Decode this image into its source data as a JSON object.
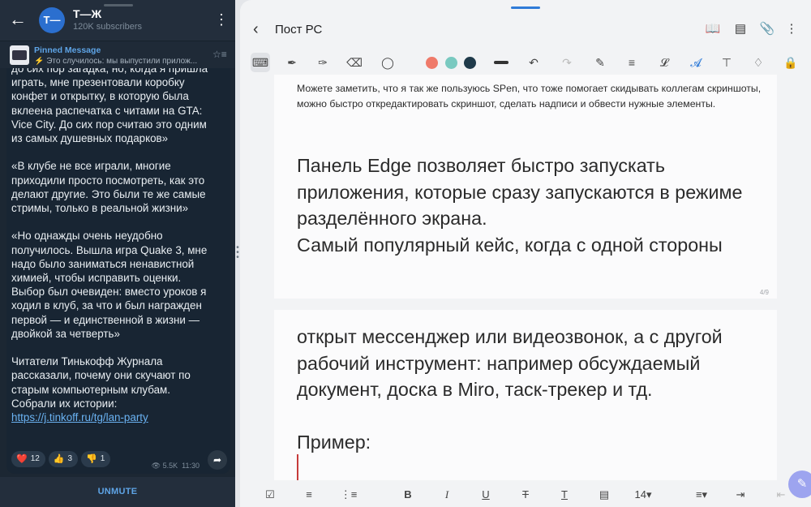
{
  "telegram": {
    "header": {
      "back_icon": "arrow-left-icon",
      "avatar_text": "Т—Ж",
      "channel_name": "Т—Ж",
      "subscribers": "120K subscribers",
      "menu_icon": "kebab-icon"
    },
    "pinned": {
      "title": "Pinned Message",
      "text": "⚡ Это случилось: мы выпустили прилож..."
    },
    "message": {
      "text_before_link": "до сих пор загадка, но, когда я пришла играть, мне презентовали коробку конфет и открытку, в которую была вклеена распечатка с читами на GTA: Vice City. До сих пор считаю это одним из самых душевных подарков»\n\n«В клубе не все играли, многие приходили просто посмотреть, как это делают другие. Это были те же самые стримы, только в реальной жизни»\n\n«Но однажды очень неудобно получилось. Вышла игра Quake 3, мне надо было заниматься ненавистной химией, чтобы исправить оценки. Выбор был очевиден: вместо уроков я ходил в клуб, за что и был награжден первой — и единственной в жизни — двойкой за четверть»\n\nЧитатели Тинькофф Журнала рассказали, почему они скучают по старым компьютерным клубам. Собрали их истории:\n",
      "link": "https://j.tinkoff.ru/tg/lan-party",
      "reactions": [
        {
          "emoji": "❤️",
          "count": "12"
        },
        {
          "emoji": "👍",
          "count": "3"
        },
        {
          "emoji": "👎",
          "count": "1"
        }
      ],
      "views": "5.5K",
      "time": "11:30"
    },
    "unmute_label": "UNMUTE"
  },
  "notes": {
    "title": "Пост РС",
    "small_text": "Можете заметить, что я так же пользуюсь SPen, что тоже помогает скидывать коллегам скриншоты, можно быстро откредактировать скриншот, сделать надписи и обвести нужные элементы.",
    "big_text_page1": "Панель Edge позволяет быстро запускать приложения, которые сразу запускаются в режиме разделённого экрана.\nСамый популярный кейс, когда с одной стороны",
    "page_number": "4/9",
    "big_text_page2": "открыт мессенджер или видеозвонок, а с другой рабочий инструмент: например обсуждаемый документ, доска в Miro, таск-трекер и тд.\n\nПример:",
    "font_size": "14▾",
    "colors": {
      "swatch1": "#ef7a6a",
      "swatch2": "#79c9c0",
      "swatch3": "#1f3a4a",
      "accent": "#2f7bd8"
    }
  }
}
